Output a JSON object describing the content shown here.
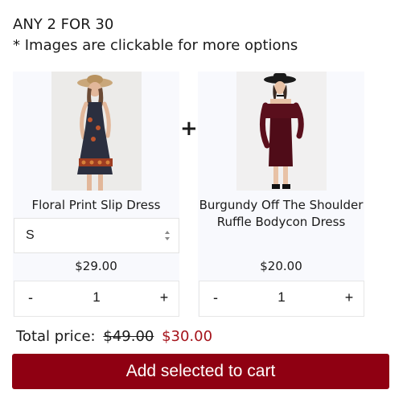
{
  "promo": {
    "title": "ANY 2 FOR 30",
    "note": "* Images are clickable for more options"
  },
  "joiner_symbol": "+",
  "products": [
    {
      "name": "Floral Print Slip Dress",
      "size_selected": "S",
      "price": "$29.00",
      "qty": "1",
      "minus": "-",
      "plus": "+",
      "dress_color": "#2b2f3f"
    },
    {
      "name": "Burgundy Off The Shoulder Ruffle Bodycon Dress",
      "price": "$20.00",
      "qty": "1",
      "minus": "-",
      "plus": "+",
      "dress_color": "#5a0f1c"
    }
  ],
  "total": {
    "label": "Total price:",
    "original": "$49.00",
    "discounted": "$30.00"
  },
  "cart_button": "Add selected to cart",
  "colors": {
    "accent": "#8f0012",
    "sale_price": "#a5131b",
    "card_bg": "#f8f9fd"
  }
}
